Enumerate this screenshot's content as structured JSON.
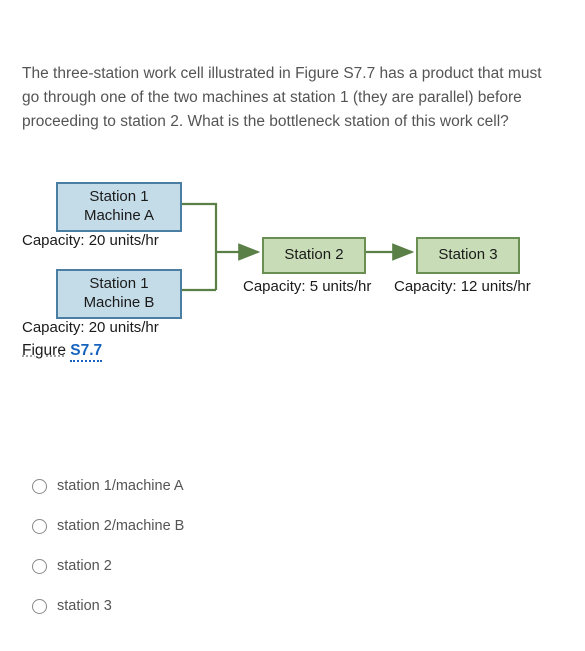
{
  "question": "The three-station work cell illustrated in Figure S7.7 has a product that must go through one of the two machines at station 1 (they are parallel) before proceeding to station 2. What is the bottleneck station of this work cell?",
  "diagram": {
    "node1a": {
      "line1": "Station 1",
      "line2": "Machine A"
    },
    "cap1a": "Capacity: 20 units/hr",
    "node1b": {
      "line1": "Station 1",
      "line2": "Machine B"
    },
    "cap1b": "Capacity: 20 units/hr",
    "node2": "Station 2",
    "cap2": "Capacity: 5 units/hr",
    "node3": "Station 3",
    "cap3": "Capacity: 12 units/hr",
    "figure_word": "Figure",
    "figure_num": "S7.7"
  },
  "options": [
    "station 1/machine A",
    "station 2/machine B",
    "station 2",
    "station 3"
  ]
}
